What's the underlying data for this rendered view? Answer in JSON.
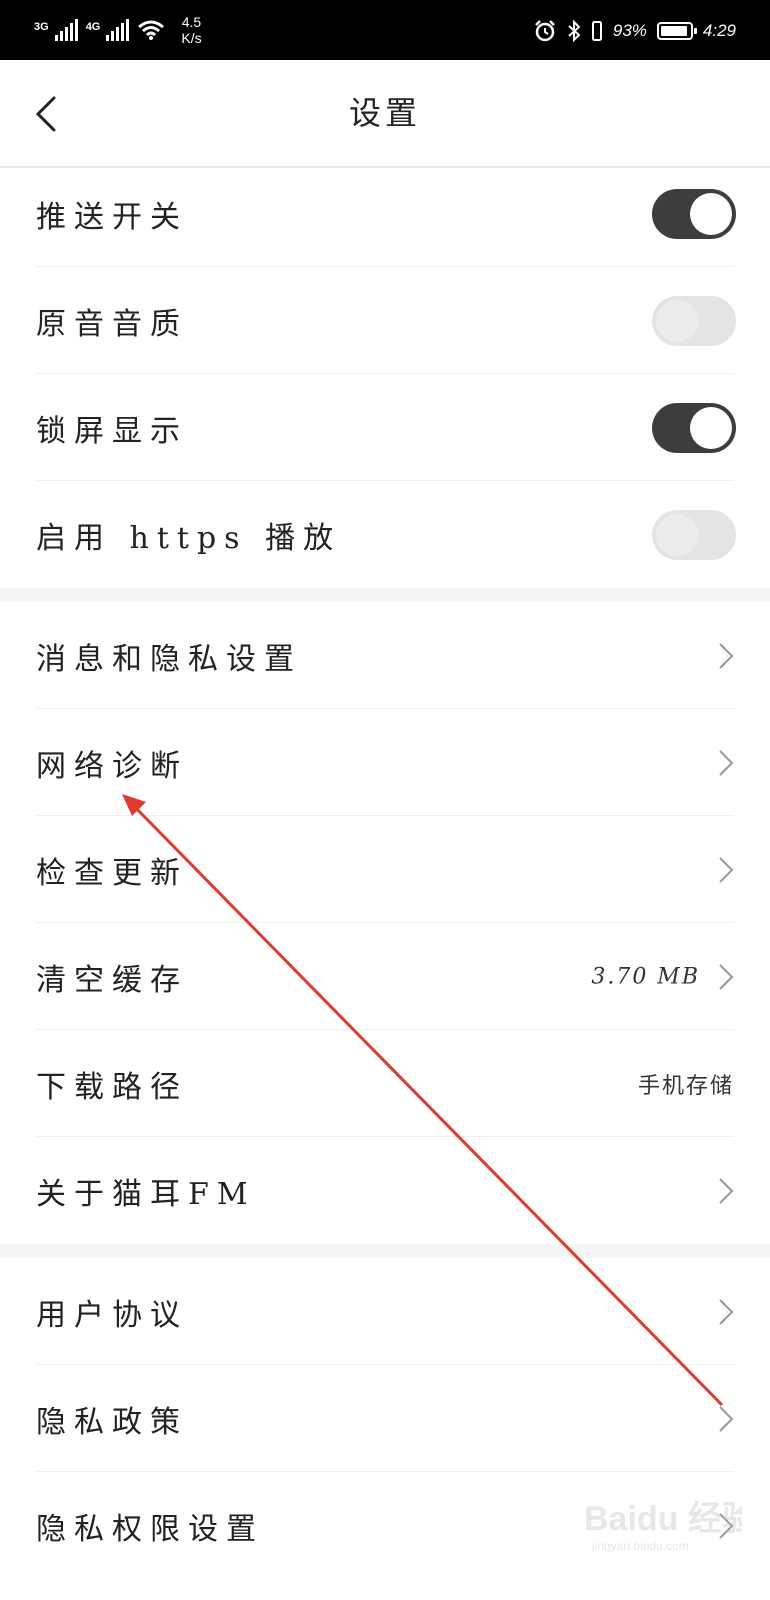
{
  "status_bar": {
    "network1": "3G",
    "network2": "4G",
    "speed_value": "4.5",
    "speed_unit": "K/s",
    "battery_percent": "93%",
    "time": "4:29",
    "icons": [
      "signal-icon",
      "wifi-icon",
      "alarm-icon",
      "bluetooth-icon",
      "vibrate-icon",
      "battery-icon"
    ],
    "battery_level": 0.93
  },
  "header": {
    "title": "设置",
    "back_icon": "chevron-left-icon"
  },
  "toggles": [
    {
      "label": "推送开关",
      "on": true
    },
    {
      "label": "原音音质",
      "on": false
    },
    {
      "label": "锁屏显示",
      "on": true
    },
    {
      "label": "启用 https 播放",
      "on": false
    }
  ],
  "menu": [
    {
      "label": "消息和隐私设置",
      "value": "",
      "chevron": true
    },
    {
      "label": "网络诊断",
      "value": "",
      "chevron": true
    },
    {
      "label": "检查更新",
      "value": "",
      "chevron": true
    },
    {
      "label": "清空缓存",
      "value": "3.70 MB",
      "chevron": true
    },
    {
      "label": "下载路径",
      "value": "手机存储",
      "chevron": false
    },
    {
      "label": "关于猫耳FM",
      "value": "",
      "chevron": true
    }
  ],
  "legal": [
    {
      "label": "用户协议",
      "chevron": true
    },
    {
      "label": "隐私政策",
      "chevron": true
    },
    {
      "label": "隐私权限设置",
      "chevron": true
    }
  ],
  "watermark": {
    "brand": "Baidu 经验",
    "url": "jingyan.baidu.com"
  },
  "annotation": {
    "arrow_color": "#e03a2f",
    "arrow_icon": "red-arrow-annotation"
  }
}
